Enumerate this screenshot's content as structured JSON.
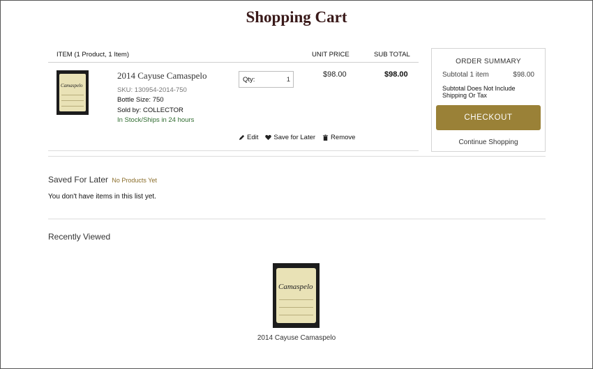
{
  "page": {
    "title": "Shopping Cart"
  },
  "cart": {
    "header": {
      "item": "ITEM (1 Product, 1 Item)",
      "unit_price": "UNIT PRICE",
      "sub_total": "SUB TOTAL"
    },
    "items": [
      {
        "name": "2014 Cayuse Camaspelo",
        "label_script": "Camaspelo",
        "sku": "SKU: 130954-2014-750",
        "bottle_size": "Bottle Size: 750",
        "sold_by": "Sold by: COLLECTOR",
        "stock": "In Stock/Ships in 24 hours",
        "qty_label": "Qty:",
        "qty_value": "1",
        "unit_price": "$98.00",
        "sub_total": "$98.00",
        "actions": {
          "edit": "Edit",
          "save": "Save for Later",
          "remove": "Remove"
        }
      }
    ]
  },
  "summary": {
    "title": "ORDER SUMMARY",
    "subtotal_label": "Subtotal 1 item",
    "subtotal_value": "$98.00",
    "note": "Subtotal Does Not Include Shipping Or Tax",
    "checkout_label": "CHECKOUT",
    "continue_label": "Continue Shopping"
  },
  "saved": {
    "title": "Saved For Later",
    "badge": "No Products Yet",
    "empty_text": "You don't have items in this list yet."
  },
  "recent": {
    "title": "Recently Viewed",
    "items": [
      {
        "name": "2014 Cayuse Camaspelo",
        "label_script": "Camaspelo"
      }
    ]
  },
  "colors": {
    "accent": "#9a8137",
    "stock": "#2f6b2f",
    "title": "#3a1a1a"
  },
  "icons": {
    "edit": "pencil-icon",
    "save": "heart-icon",
    "remove": "trash-icon"
  }
}
